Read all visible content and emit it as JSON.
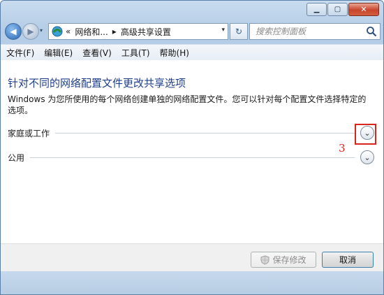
{
  "window": {
    "caption": {
      "minimize": "▁",
      "maximize": "▢",
      "close": "✕"
    }
  },
  "address": {
    "recent": "▾",
    "prefix": "«",
    "crumb1": "网络和...",
    "sep": "▸",
    "crumb2": "高级共享设置",
    "dropdown": "▾",
    "refresh": "↻"
  },
  "search": {
    "placeholder": "搜索控制面板"
  },
  "menu": [
    "文件(F)",
    "编辑(E)",
    "查看(V)",
    "工具(T)",
    "帮助(H)"
  ],
  "content": {
    "title": "针对不同的网络配置文件更改共享选项",
    "description": "Windows 为您所使用的每个网络创建单独的网络配置文件。您可以针对每个配置文件选择特定的选项。",
    "sections": [
      {
        "label": "家庭或工作"
      },
      {
        "label": "公用"
      }
    ],
    "chevron": "⌄",
    "annotation": "3"
  },
  "footer": {
    "save_label": "保存修改",
    "cancel_label": "取消"
  },
  "colors": {
    "title": "#1f3f8a",
    "highlight": "#d9261c"
  }
}
